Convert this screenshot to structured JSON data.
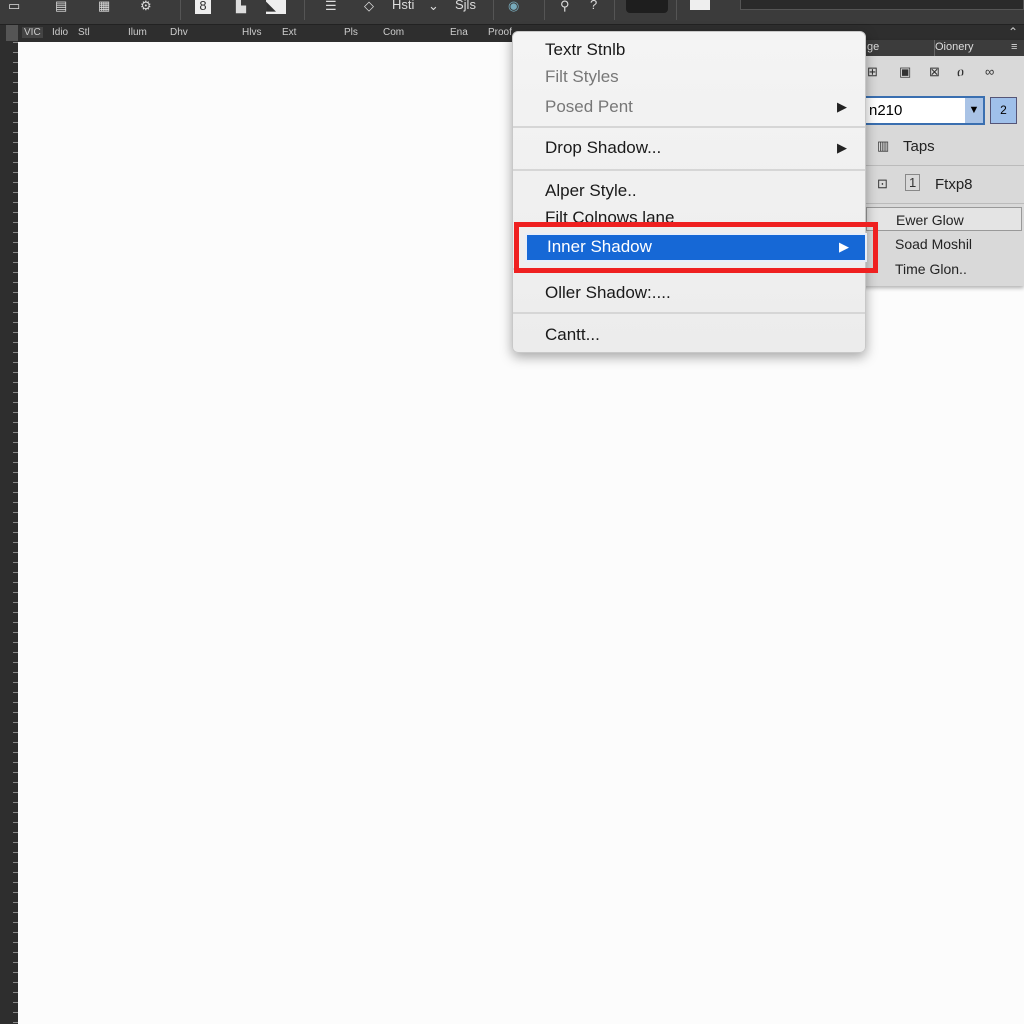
{
  "toolbar": {
    "labels": [
      "Hsti",
      "Sjls",
      "?"
    ]
  },
  "ruler": {
    "labels": [
      "VIC",
      "Idio",
      "Stl",
      "Ilum",
      "Dhv",
      "Hlvs",
      "Ext",
      "Pls",
      "Com",
      "Ena",
      "Proof"
    ]
  },
  "panel": {
    "header": {
      "left": "ge",
      "right": "Oionery"
    },
    "combo_value": "n210",
    "combo_button": "2",
    "rows": [
      {
        "label": "Taps"
      },
      {
        "label": "Ftxp8"
      }
    ],
    "submenu": [
      "Ewer Glow",
      "Soad Moshil",
      "Time Glon.."
    ]
  },
  "menu": {
    "items": [
      {
        "label": "Textr Stnlb",
        "disabled": false
      },
      {
        "label": "Filt Styles",
        "disabled": true
      },
      {
        "label": "Posed Pent",
        "disabled": true,
        "submenu": true
      },
      {
        "label": "Drop Shadow...",
        "submenu": true
      },
      {
        "label": "Alper Style.."
      },
      {
        "label": "Filt Colnows lane"
      },
      {
        "label": "Inner Shadow",
        "submenu": true,
        "highlighted": true
      },
      {
        "label": "Oller Shadow:...."
      },
      {
        "label": "Cantt..."
      }
    ],
    "highlight_color": "#1668d6",
    "annotation_color": "#ef2020"
  }
}
